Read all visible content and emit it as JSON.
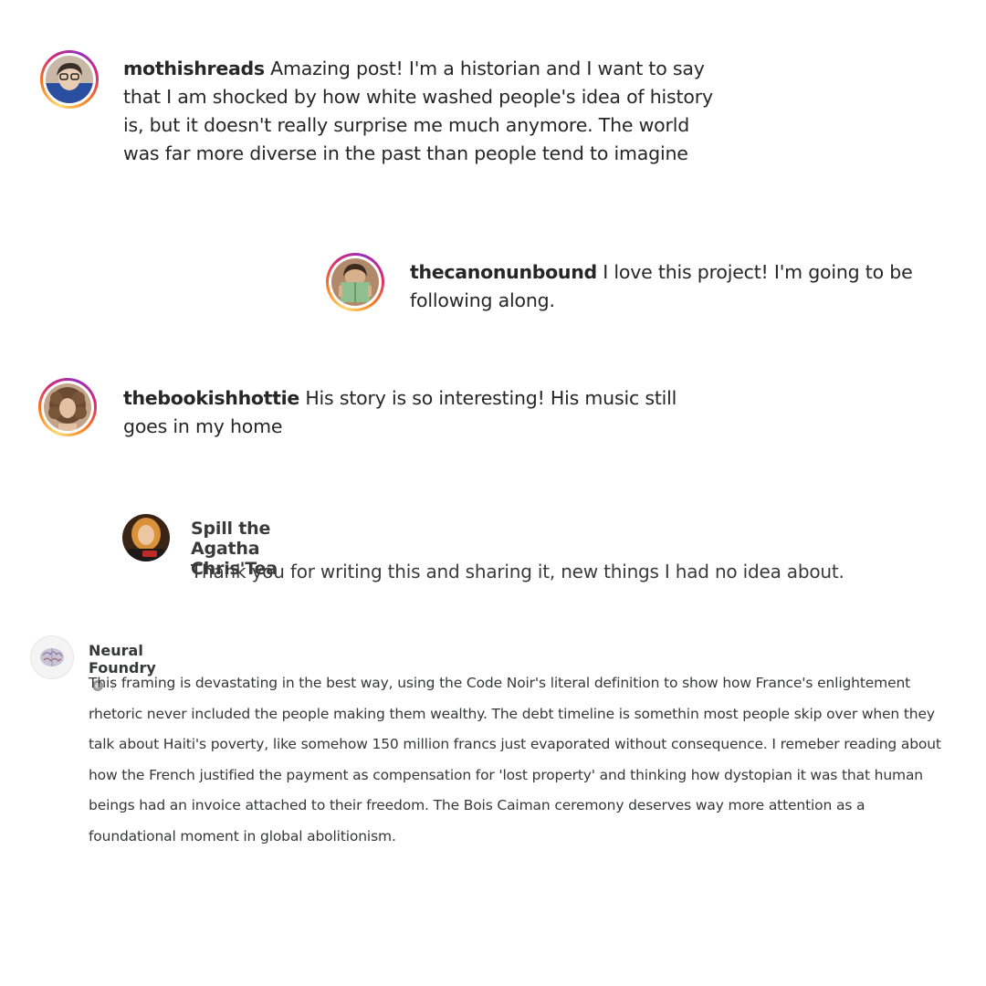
{
  "comments": [
    {
      "username": "mothishreads",
      "text": "Amazing post! I'm a historian and I want to say that I am shocked by how white washed people's idea of history is, but it doesn't really surprise me much anymore. The world was far more diverse in the past than people tend to imagine"
    },
    {
      "username": "thecanonunbound",
      "text": "I love this project! I'm going to be following along."
    },
    {
      "username": "thebookishhottie",
      "text": "His story is so interesting! His music still goes in my home"
    }
  ],
  "reply": {
    "name": "Spill the Agatha Chris'Tea",
    "text": "Thank you for writing this and sharing it, new things I had no idea about."
  },
  "neural_foundry": {
    "name": "Neural Foundry",
    "text": "This framing is devastating in the best way, using the Code Noir's literal definition to show how France's enlightement rhetoric never included the people making them wealthy. The debt timeline is somethin most people skip over when they talk about Haiti's poverty, like somehow 150 million francs just evaporated without consequence. I remeber reading about how the French justified the payment as compensation for 'lost property' and thinking how dystopian it was that human beings had an invoice attached to their freedom. The Bois Caiman ceremony deserves way more attention as a foundational moment in global abolitionism."
  }
}
